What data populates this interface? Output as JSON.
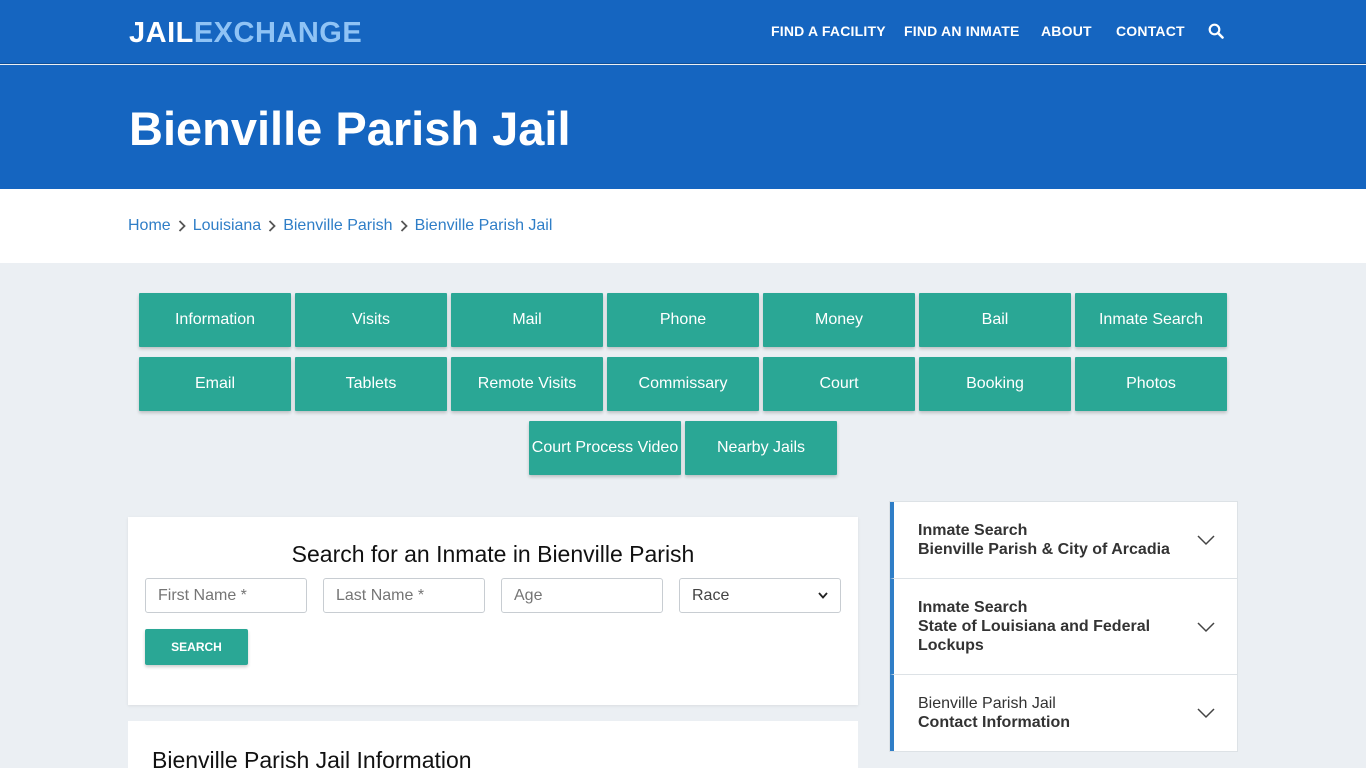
{
  "header": {
    "logo_part1": "JAIL",
    "logo_part2": "EXCHANGE",
    "nav": [
      "FIND A FACILITY",
      "FIND AN INMATE",
      "ABOUT",
      "CONTACT"
    ]
  },
  "hero": {
    "title": "Bienville Parish Jail"
  },
  "breadcrumb": [
    "Home",
    "Louisiana",
    "Bienville Parish",
    "Bienville Parish Jail"
  ],
  "tiles": [
    "Information",
    "Visits",
    "Mail",
    "Phone",
    "Money",
    "Bail",
    "Inmate Search",
    "Email",
    "Tablets",
    "Remote Visits",
    "Commissary",
    "Court",
    "Booking",
    "Photos",
    "Court Process Video",
    "Nearby Jails"
  ],
  "search": {
    "heading": "Search for an Inmate in Bienville Parish",
    "first_name_placeholder": "First Name *",
    "last_name_placeholder": "Last Name *",
    "age_placeholder": "Age",
    "race_selected": "Race",
    "button": "SEARCH"
  },
  "info": {
    "heading": "Bienville Parish Jail Information"
  },
  "sidebar": [
    {
      "line1": "Inmate Search",
      "line2": "Bienville Parish & City of Arcadia"
    },
    {
      "line1": "Inmate Search",
      "line2": "State of Louisiana and Federal Lockups"
    },
    {
      "line1": "Bienville Parish Jail",
      "line2": "Contact Information"
    }
  ],
  "colors": {
    "brand_blue": "#1565c0",
    "teal": "#2aa795",
    "link": "#2f7ec7"
  }
}
